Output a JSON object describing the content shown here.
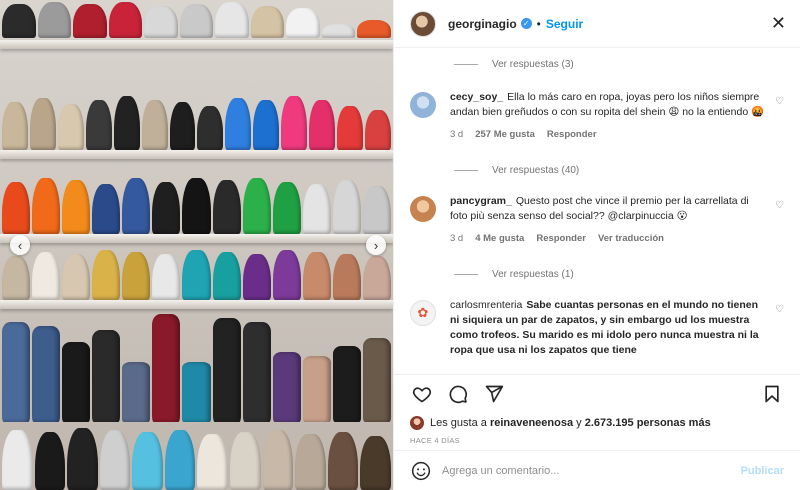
{
  "header": {
    "username": "georginagio",
    "separator": "•",
    "follow_label": "Seguir",
    "verified_glyph": "✓",
    "close_glyph": "✕"
  },
  "photo": {
    "prev_glyph": "‹",
    "next_glyph": "›"
  },
  "comments": [
    {
      "type": "replies",
      "label": "Ver respuestas (3)"
    },
    {
      "type": "comment",
      "user": "cecy_soy_",
      "text": "Ella lo más caro en ropa, joyas pero los niños siempre andan bien greñudos o con su ropita del shein 😩 no la entiendo 🤬",
      "time": "3 d",
      "likes": "257 Me gusta",
      "reply": "Responder",
      "translate": "",
      "avatar_color": "#8fb3d9"
    },
    {
      "type": "replies",
      "label": "Ver respuestas (40)"
    },
    {
      "type": "comment",
      "user": "pancygram_",
      "text": "Questo post che vince il premio per la carrellata di foto più senza senso del social?? @clarpinuccia 😮",
      "time": "3 d",
      "likes": "4 Me gusta",
      "reply": "Responder",
      "translate": "Ver traducción",
      "avatar_color": "#c7834f"
    },
    {
      "type": "replies",
      "label": "Ver respuestas (1)"
    },
    {
      "type": "comment",
      "user": "carlosmrenteria",
      "text": "Sabe cuantas personas en el mundo no tienen ni siquiera un par de zapatos, y sin embargo ud los muestra como trofeos. Su marido es mi idolo pero nunca muestra ni la ropa que usa ni los zapatos que tiene",
      "time": "",
      "likes": "",
      "reply": "",
      "translate": "",
      "avatar_color": "#f3f3f3"
    }
  ],
  "actions": {
    "like_icon": "heart-icon",
    "comment_icon": "comment-icon",
    "share_icon": "send-icon",
    "save_icon": "bookmark-icon"
  },
  "likes": {
    "prefix": "Les gusta a",
    "user": "reinaveneenosa",
    "connector": "y",
    "count": "2.673.195 personas más"
  },
  "date": "HACE 4 DÍAS",
  "add_comment": {
    "placeholder": "Agrega un comentario...",
    "publish_label": "Publicar"
  }
}
